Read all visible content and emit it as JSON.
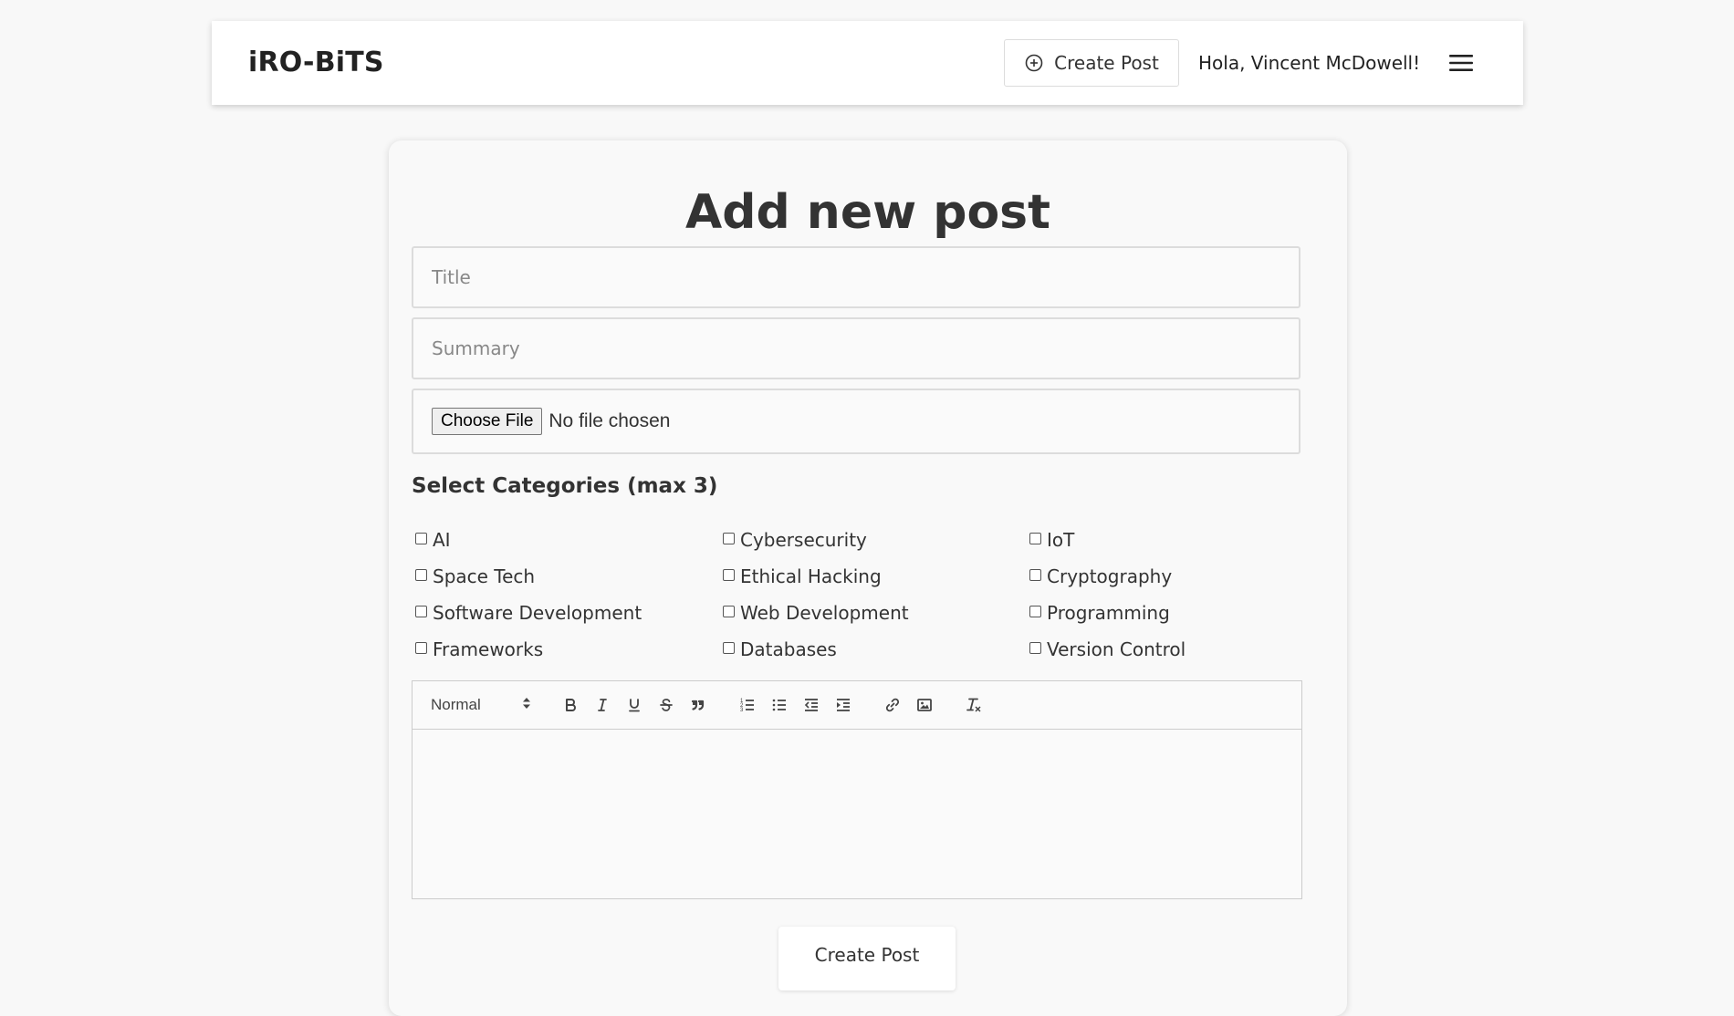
{
  "header": {
    "logo": "iRO-BiTS",
    "create_post_label": "Create Post",
    "greeting": "Hola, Vincent McDowell!"
  },
  "form": {
    "heading": "Add new post",
    "title_placeholder": "Title",
    "summary_placeholder": "Summary",
    "file_button_label": "Choose File",
    "file_status": "No file chosen",
    "categories_heading": "Select Categories (max 3)",
    "categories": [
      "AI",
      "Cybersecurity",
      "IoT",
      "Space Tech",
      "Ethical Hacking",
      "Cryptography",
      "Software Development",
      "Web Development",
      "Programming",
      "Frameworks",
      "Databases",
      "Version Control"
    ],
    "submit_label": "Create Post"
  },
  "editor": {
    "heading_select_value": "Normal",
    "toolbar_icons": [
      "bold-icon",
      "italic-icon",
      "underline-icon",
      "strikethrough-icon",
      "blockquote-icon",
      "ordered-list-icon",
      "bullet-list-icon",
      "outdent-icon",
      "indent-icon",
      "link-icon",
      "image-icon",
      "clear-format-icon"
    ]
  },
  "colors": {
    "background": "#f8f8f8",
    "card": "#f9f9f9",
    "text": "#333333",
    "border": "#dcdcdc"
  }
}
